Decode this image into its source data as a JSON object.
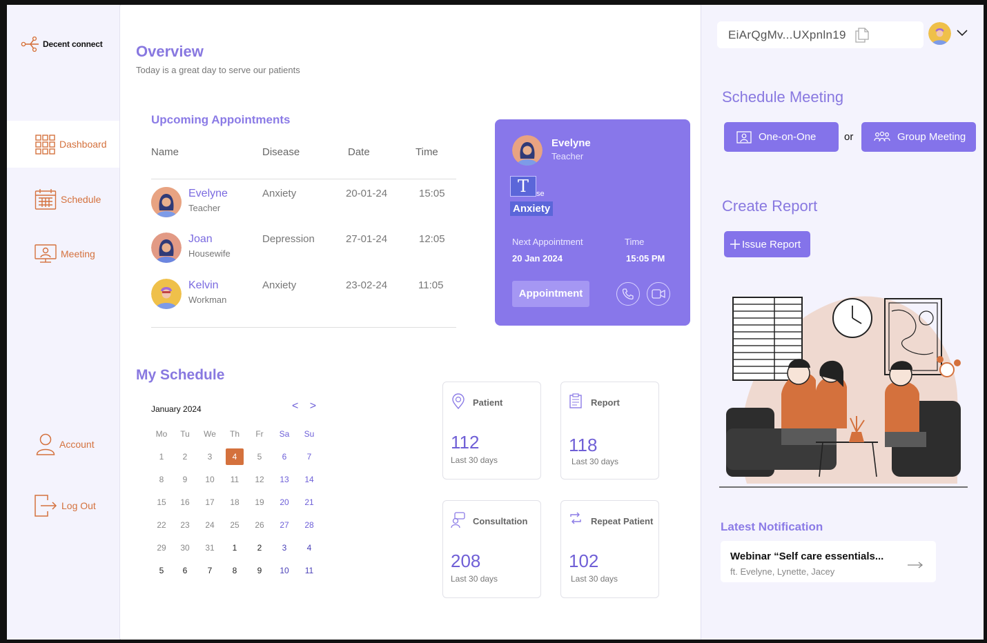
{
  "brand": {
    "name": "Decent connect",
    "accent": "#8473ea",
    "orange": "#d4713d"
  },
  "sidebar": {
    "items": [
      {
        "label": "Dashboard",
        "icon": "grid-icon"
      },
      {
        "label": "Schedule",
        "icon": "calendar-icon"
      },
      {
        "label": "Meeting",
        "icon": "monitor-user-icon"
      },
      {
        "label": "Account",
        "icon": "user-icon"
      },
      {
        "label": "Log Out",
        "icon": "logout-icon"
      }
    ]
  },
  "overview": {
    "title": "Overview",
    "subtitle": "Today is a great day to serve our patients"
  },
  "appointments": {
    "title": "Upcoming Appointments",
    "columns": [
      "Name",
      "Disease",
      "Date",
      "Time"
    ],
    "rows": [
      {
        "name": "Evelyne",
        "job": "Teacher",
        "disease": "Anxiety",
        "date": "20-01-24",
        "time": "15:05"
      },
      {
        "name": "Joan",
        "job": "Housewife",
        "disease": "Depression",
        "date": "27-01-24",
        "time": "12:05"
      },
      {
        "name": "Kelvin",
        "job": "Workman",
        "disease": "Anxiety",
        "date": "23-02-24",
        "time": "11:05"
      }
    ]
  },
  "patient_card": {
    "name": "Evelyne",
    "job": "Teacher",
    "t_glyph": "T",
    "partial_label": "se",
    "disease": "Anxiety",
    "next_label": "Next Appointment",
    "next_value": "20 Jan 2024",
    "time_label": "Time",
    "time_value": "15:05 PM",
    "button": "Appointment"
  },
  "schedule": {
    "title": "My Schedule",
    "month": "January 2024",
    "prev": "<",
    "next": ">",
    "weekdays": [
      "Mo",
      "Tu",
      "We",
      "Th",
      "Fr",
      "Sa",
      "Su"
    ],
    "weeks": [
      [
        "1",
        "2",
        "3",
        "4",
        "5",
        "6",
        "7"
      ],
      [
        "8",
        "9",
        "10",
        "11",
        "12",
        "13",
        "14"
      ],
      [
        "15",
        "16",
        "17",
        "18",
        "19",
        "20",
        "21"
      ],
      [
        "22",
        "23",
        "24",
        "25",
        "26",
        "27",
        "28"
      ],
      [
        "29",
        "30",
        "31",
        "1",
        "2",
        "3",
        "4"
      ],
      [
        "5",
        "6",
        "7",
        "8",
        "9",
        "10",
        "11"
      ]
    ],
    "today": "4"
  },
  "stats": [
    {
      "label": "Patient",
      "value": "112",
      "sub": "Last 30 days",
      "icon": "location-brain-icon"
    },
    {
      "label": "Report",
      "value": "118",
      "sub": "Last 30 days",
      "icon": "clipboard-icon"
    },
    {
      "label": "Consultation",
      "value": "208",
      "sub": "Last 30 days",
      "icon": "consultation-icon"
    },
    {
      "label": "Repeat Patient",
      "value": "102",
      "sub": "Last 30 days",
      "icon": "repeat-icon"
    }
  ],
  "right": {
    "wallet": "EiArQgMv...UXpnln19",
    "schedule_title": "Schedule Meeting",
    "one_on_one": "One-on-One",
    "or": "or",
    "group": "Group Meeting",
    "report_title": "Create Report",
    "issue": "Issue Report",
    "notif_title": "Latest Notification",
    "notif_head": "Webinar “Self care essentials...",
    "notif_sub": "ft. Evelyne, Lynette, Jacey"
  }
}
